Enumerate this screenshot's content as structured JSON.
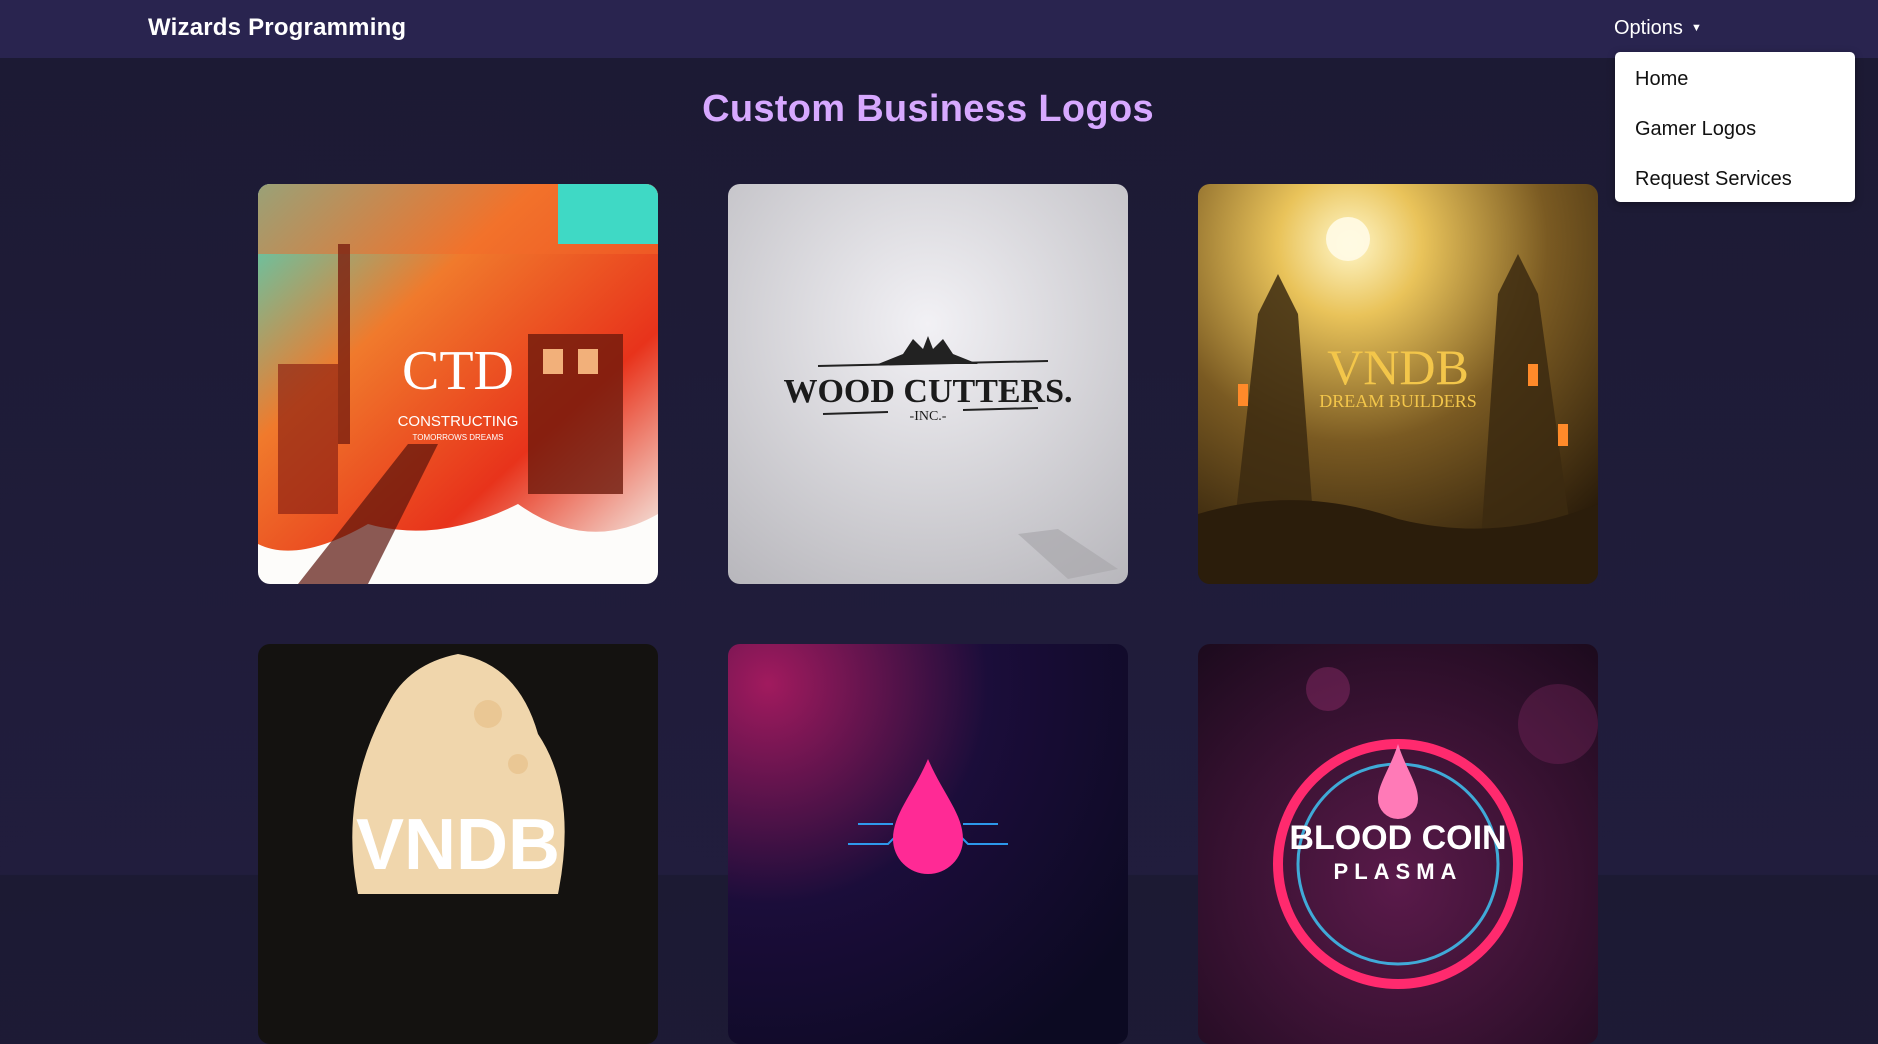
{
  "navbar": {
    "brand": "Wizards Programming",
    "options_label": "Options",
    "caret_icon": "caret-down-icon"
  },
  "dropdown": {
    "items": [
      {
        "label": "Home"
      },
      {
        "label": "Gamer Logos"
      },
      {
        "label": "Request Services"
      }
    ]
  },
  "page": {
    "title": "Custom Business Logos"
  },
  "logos": [
    {
      "name": "CTD",
      "tagline_1": "CONSTRUCTING",
      "tagline_2": "TOMORROWS DREAMS"
    },
    {
      "name": "WOOD CUTTERS.",
      "tagline_1": "-INC.-"
    },
    {
      "name": "VNDB",
      "tagline_1": "DREAM BUILDERS"
    },
    {
      "name": "VNDB"
    },
    {
      "name": ""
    },
    {
      "name": "BLOOD COIN",
      "tagline_1": "PLASMA"
    }
  ],
  "colors": {
    "navbar": "#29244f",
    "background": "#1c1a33",
    "heading": "#d7a8ff",
    "dropdown_bg": "#ffffff"
  }
}
